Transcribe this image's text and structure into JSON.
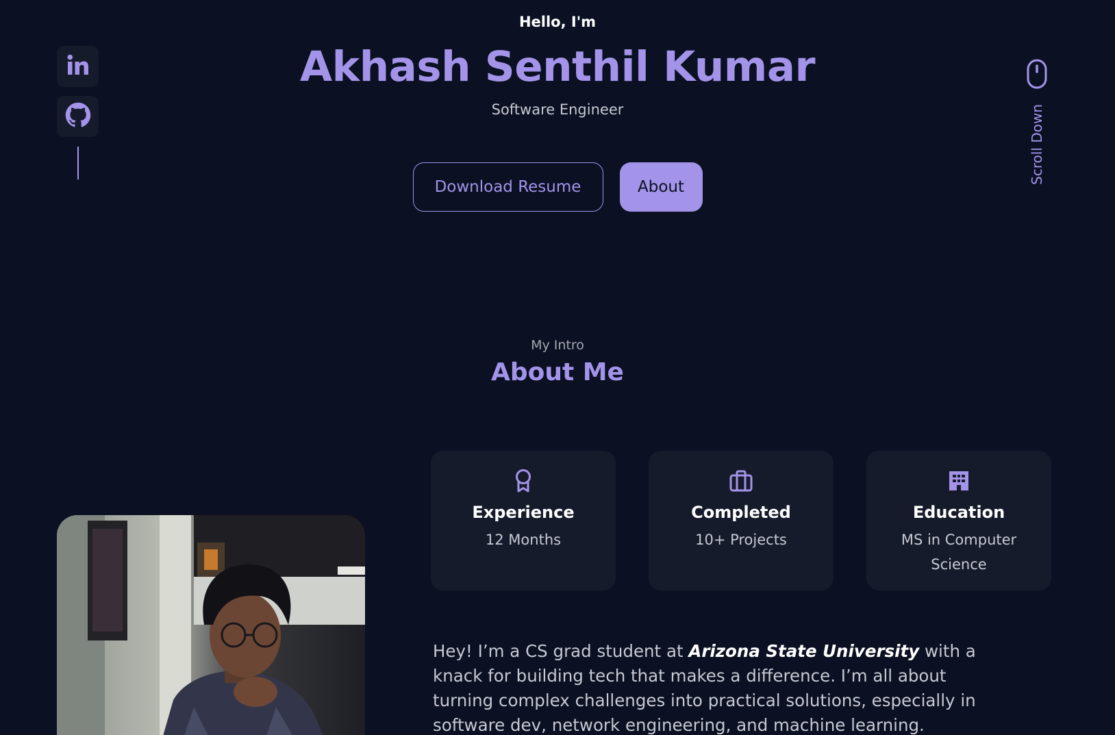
{
  "hero": {
    "greeting": "Hello, I'm",
    "name": "Akhash Senthil Kumar",
    "role": "Software Engineer",
    "download_label": "Download Resume",
    "about_label": "About"
  },
  "social": {
    "items": [
      {
        "name": "LinkedIn",
        "icon": "linkedin-icon"
      },
      {
        "name": "GitHub",
        "icon": "github-icon"
      }
    ]
  },
  "scroll": {
    "label": "Scroll Down",
    "icon": "mouse-icon"
  },
  "about": {
    "subtitle": "My Intro",
    "title": "About Me",
    "cards": [
      {
        "icon": "award-icon",
        "title": "Experience",
        "value": "12 Months"
      },
      {
        "icon": "briefcase-icon",
        "title": "Completed",
        "value": "10+ Projects"
      },
      {
        "icon": "building-icon",
        "title": "Education",
        "value": "MS in Computer Science"
      }
    ],
    "intro_before": "Hey! I’m a CS grad student at ",
    "university": "Arizona State University",
    "intro_after": " with a knack for building tech that makes a difference. I’m all about turning complex challenges into practical solutions, especially in software dev, network engineering, and machine learning."
  },
  "colors": {
    "background": "#0b1022",
    "accent": "#a394ea",
    "card": "#161b2b",
    "text_muted": "#c7c9d3"
  }
}
